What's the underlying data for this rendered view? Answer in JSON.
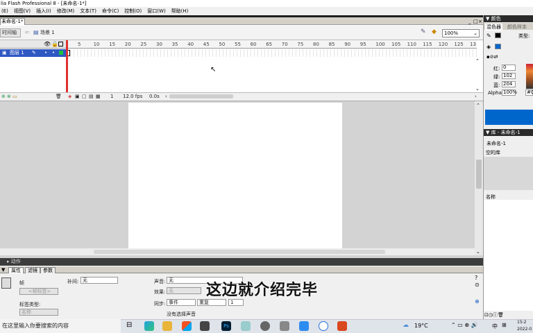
{
  "window": {
    "title": "lia Flash Professional 8 - [未命名-1*]",
    "minimize": "_",
    "maximize": "□",
    "close": "×"
  },
  "menu": [
    "(E)",
    "视图(V)",
    "插入(I)",
    "修改(M)",
    "文本(T)",
    "命令(C)",
    "控制(O)",
    "窗口(W)",
    "帮助(H)"
  ],
  "doc": {
    "tab": "未命名-1*",
    "timeline_button": "时间轴",
    "scene": "场景 1",
    "zoom": "100%"
  },
  "timeline": {
    "layer_name": "图层 1",
    "ruler_ticks": [
      "5",
      "10",
      "15",
      "20",
      "25",
      "30",
      "35",
      "40",
      "45",
      "50",
      "55",
      "60",
      "65",
      "70",
      "75",
      "80",
      "85",
      "90",
      "95",
      "100",
      "105",
      "110",
      "115",
      "120",
      "125",
      "13"
    ],
    "current_frame": "1",
    "fps": "12.0 fps",
    "time": "0.0s"
  },
  "actions_bar": "▸ 动作",
  "properties": {
    "tabs": [
      "属性",
      "滤镜",
      "参数"
    ],
    "frame_label": "帧",
    "frame_name_placeholder": "<帧标签>",
    "tween_label": "补间:",
    "tween_value": "无",
    "label_type_label": "标签类型:",
    "label_type_value": "名称",
    "sound_label": "声音:",
    "sound_value": "无",
    "effect_label": "效果:",
    "effect_value": "无",
    "sync_label": "同步:",
    "sync_value": "事件",
    "repeat_value": "重复",
    "repeat_count": "1",
    "no_sound": "没有选择声音"
  },
  "subtitle": "这边就介绍完毕",
  "color_panel": {
    "title": "▼ 颜色",
    "tab_mixer": "混色器",
    "tab_swatches": "颜色样本",
    "type_label": "类型:",
    "red_label": "红:",
    "red_value": "0",
    "green_label": "绿:",
    "green_value": "102",
    "blue_label": "蓝:",
    "blue_value": "204",
    "alpha_label": "Alpha:",
    "alpha_value": "100%",
    "hex_value": "#00",
    "swatch_color": "#0066cc"
  },
  "library_panel": {
    "title": "▼ 库 - 未命名-1",
    "doc_name": "未命名-1",
    "empty_text": "空的库",
    "name_header": "名称"
  },
  "taskbar": {
    "search_placeholder": "在这里输入你要搜索的内容",
    "weather": "19°C",
    "lang": "中",
    "time": "15:2",
    "date": "2022-0"
  }
}
